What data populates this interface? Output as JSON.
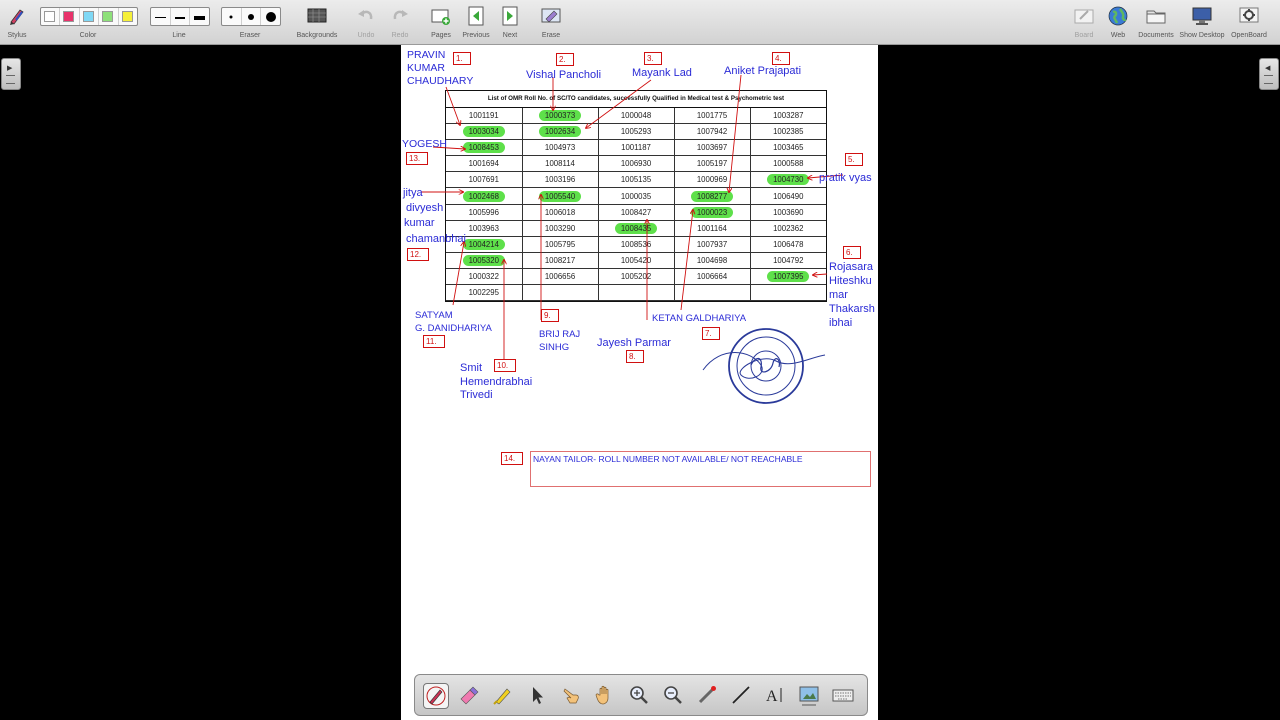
{
  "toolbar": {
    "stylus": "Stylus",
    "color": "Color",
    "line": "Line",
    "eraser": "Eraser",
    "backgrounds": "Backgrounds",
    "undo": "Undo",
    "redo": "Redo",
    "pages": "Pages",
    "previous": "Previous",
    "next": "Next",
    "erase": "Erase",
    "board": "Board",
    "web": "Web",
    "documents": "Documents",
    "show_desktop": "Show Desktop",
    "openboard": "OpenBoard",
    "colors": [
      "#ffffff",
      "#e8336b",
      "#7fd8f5",
      "#8ee07a",
      "#f5f03a"
    ]
  },
  "document": {
    "table_title": "List of OMR Roll No. of SC/TO candidates, successfully Qualified in Medical test & Psychometric test",
    "rows": [
      [
        "1001191",
        "1000373",
        "1000048",
        "1001775",
        "1003287"
      ],
      [
        "1003034",
        "1002634",
        "1005293",
        "1007942",
        "1002385"
      ],
      [
        "1008453",
        "1004973",
        "1001187",
        "1003697",
        "1003465"
      ],
      [
        "1001694",
        "1008114",
        "1006930",
        "1005197",
        "1000588"
      ],
      [
        "1007691",
        "1003196",
        "1005135",
        "1000969",
        "1004730"
      ],
      [
        "1002468",
        "1005540",
        "1000035",
        "1008277",
        "1006490"
      ],
      [
        "1005996",
        "1006018",
        "1008427",
        "1000023",
        "1003690"
      ],
      [
        "1003963",
        "1003290",
        "1008435",
        "1001164",
        "1002362"
      ],
      [
        "1004214",
        "1005795",
        "1008536",
        "1007937",
        "1006478"
      ],
      [
        "1005320",
        "1008217",
        "1005420",
        "1004698",
        "1004792"
      ],
      [
        "1000322",
        "1006656",
        "1005202",
        "1006664",
        "1007395"
      ],
      [
        "1002295",
        "",
        "",
        "",
        ""
      ]
    ],
    "highlighted": [
      "1000373",
      "1003034",
      "1002634",
      "1008453",
      "1004730",
      "1002468",
      "1005540",
      "1008277",
      "1000023",
      "1008435",
      "1004214",
      "1005320",
      "1007395"
    ],
    "annotations": {
      "pravin": "PRAVIN",
      "kumar": "KUMAR",
      "chaudhary": "CHAUDHARY",
      "vishal": "Vishal Pancholi",
      "mayank": "Mayank Lad",
      "aniket": "Aniket Prajapati",
      "yogesh": "YOGESH",
      "pratik": "pratik vyas",
      "jitya": "jitya",
      "divyesh": "divyesh",
      "kumar2": "kumar",
      "chamanbhai": "chamanbhai",
      "rojasara": "Rojasara",
      "hiteshku": "Hiteshku",
      "mar": "mar",
      "thakarsh": "Thakarsh",
      "ibhai": "ibhai",
      "satyam": "SATYAM",
      "danidhariya": "G. DANIDHARIYA",
      "brij": "BRIJ RAJ",
      "sinhg": "SINHG",
      "ketan": "KETAN GALDHARIYA",
      "jayesh": "Jayesh Parmar",
      "smit": "Smit",
      "hemendrabhai": "Hemendrabhai",
      "trivedi": "Trivedi",
      "note": "NAYAN TAILOR- ROLL NUMBER NOT AVAILABLE/ NOT REACHABLE"
    },
    "numbers": [
      "1.",
      "2.",
      "3.",
      "4.",
      "5.",
      "6.",
      "7.",
      "8.",
      "9.",
      "10.",
      "11.",
      "12.",
      "13.",
      "14."
    ]
  }
}
